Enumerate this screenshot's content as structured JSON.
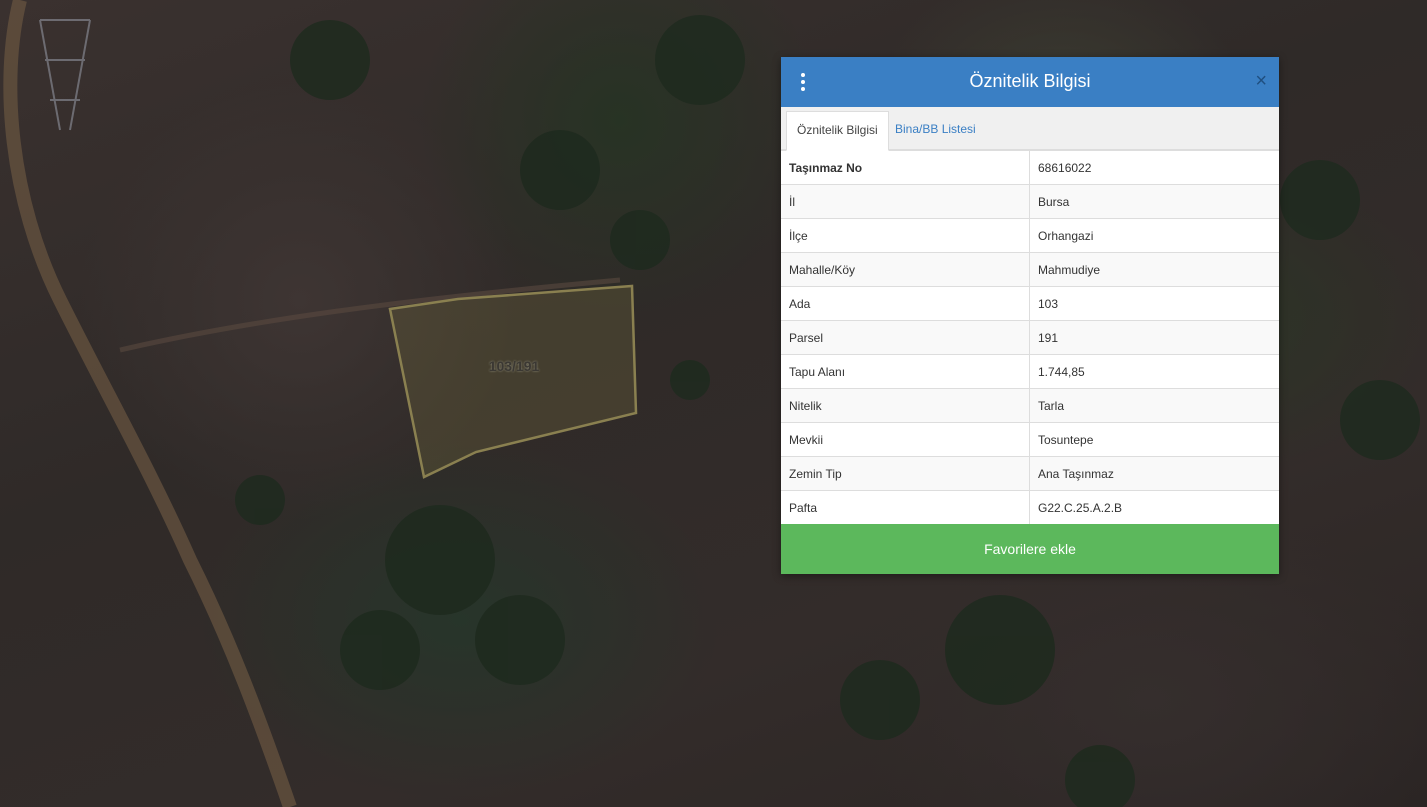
{
  "map": {
    "parcel_label": "103/191"
  },
  "panel": {
    "title": "Öznitelik Bilgisi",
    "tabs": [
      {
        "label": "Öznitelik Bilgisi",
        "active": true
      },
      {
        "label": "Bina/BB Listesi",
        "active": false
      }
    ],
    "rows": [
      {
        "key": "Taşınmaz No",
        "value": "68616022"
      },
      {
        "key": "İl",
        "value": "Bursa"
      },
      {
        "key": "İlçe",
        "value": "Orhangazi"
      },
      {
        "key": "Mahalle/Köy",
        "value": "Mahmudiye"
      },
      {
        "key": "Ada",
        "value": "103"
      },
      {
        "key": "Parsel",
        "value": "191"
      },
      {
        "key": "Tapu Alanı",
        "value": "1.744,85"
      },
      {
        "key": "Nitelik",
        "value": "Tarla"
      },
      {
        "key": "Mevkii",
        "value": "Tosuntepe"
      },
      {
        "key": "Zemin Tip",
        "value": "Ana Taşınmaz"
      },
      {
        "key": "Pafta",
        "value": "G22.C.25.A.2.B"
      }
    ],
    "favorite_button": "Favorilere ekle",
    "close_symbol": "×"
  },
  "colors": {
    "header": "#3a7fc4",
    "button": "#5cb85c",
    "parcel_outline": "#8a8050"
  },
  "icons": {
    "menu": "vertical-dots-icon",
    "close": "close-icon"
  }
}
